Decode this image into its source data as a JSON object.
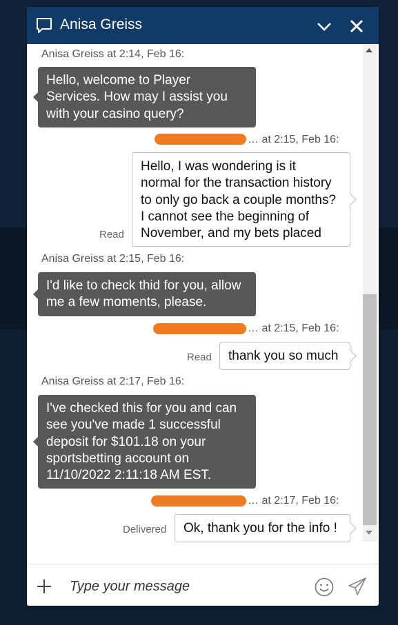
{
  "header": {
    "title": "Anisa Greiss"
  },
  "messages": [
    {
      "sender": "agent",
      "meta": "Anisa Greiss at 2:14, Feb 16:",
      "lines": [
        "Hello, welcome to Player",
        "Services. How may I assist you",
        "with your casino query?"
      ]
    },
    {
      "sender": "user",
      "meta": "… at 2:15, Feb 16:",
      "status": "Read",
      "lines": [
        "Hello, I was wondering is it",
        "normal for the transaction history",
        "to only go back a couple months?",
        "I cannot see the beginning of",
        "November, and my bets placed"
      ]
    },
    {
      "sender": "agent",
      "meta": "Anisa Greiss at 2:15, Feb 16:",
      "lines": [
        "I'd like to check thid for you, allow",
        "me a few moments, please."
      ]
    },
    {
      "sender": "user",
      "meta": "… at 2:15, Feb 16:",
      "status": "Read",
      "lines": [
        "thank you so much"
      ]
    },
    {
      "sender": "agent",
      "meta": "Anisa Greiss at 2:17, Feb 16:",
      "lines": [
        "I've checked this for you and can",
        "see you've made 1 successful",
        "deposit for $101.18 on your",
        "sportsbetting account on",
        "11/10/2022 2:11:18 AM EST."
      ]
    },
    {
      "sender": "user",
      "meta": "… at 2:17, Feb 16:",
      "status": "Delivered",
      "lines": [
        "Ok, thank you for the info !"
      ]
    }
  ],
  "composer": {
    "placeholder": "Type your message"
  },
  "icons": {
    "chat": "chat-bubble-icon",
    "minimize": "chevron-down-icon",
    "close": "close-icon",
    "attach": "plus-icon",
    "emoji": "smiley-icon",
    "send": "paper-plane-icon"
  },
  "colors": {
    "header": "#113a66",
    "agent_bubble": "#585858",
    "redaction": "#f07b22",
    "page_background": "#0f1e30"
  }
}
